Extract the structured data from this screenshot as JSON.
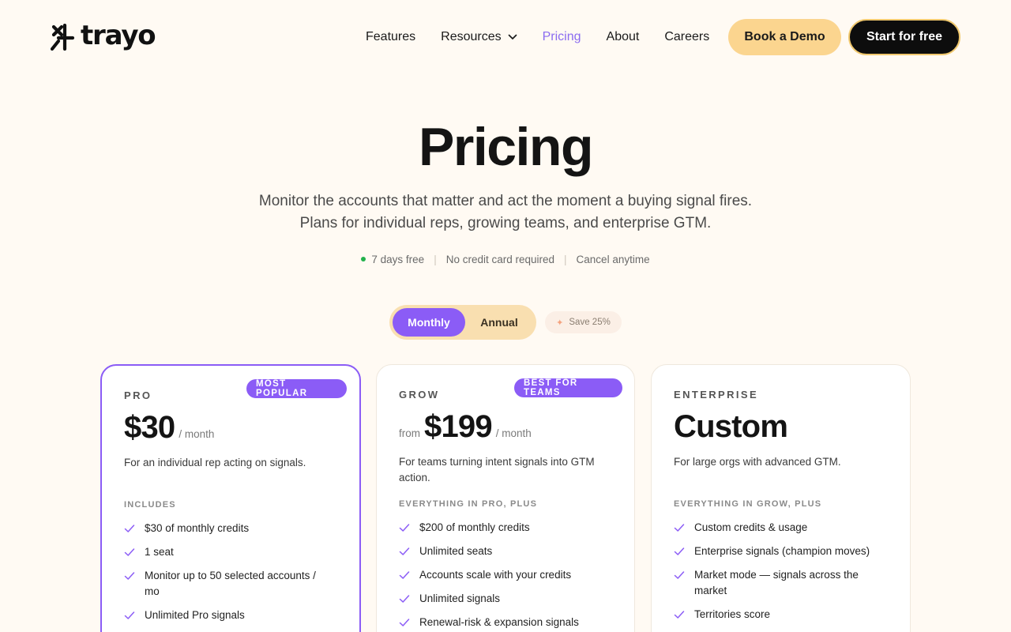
{
  "nav": {
    "logo_text": "trayo",
    "links": [
      {
        "label": "Features"
      },
      {
        "label": "Resources"
      },
      {
        "label": "Pricing"
      },
      {
        "label": "About"
      },
      {
        "label": "Careers"
      }
    ],
    "demo_label": "Book a Demo",
    "start_label": "Start for free",
    "active_link": "Pricing",
    "accent_color": "#8b6cf0"
  },
  "hero": {
    "title": "Pricing",
    "subtitle_line1": "Monitor the accounts that matter and act the moment a buying signal fires.",
    "subtitle_line2": "Plans for individual reps, growing teams, and enterprise GTM.",
    "badges": [
      "7 days free",
      "No credit card required",
      "Cancel anytime"
    ]
  },
  "billing": {
    "monthly_label": "Monthly",
    "annual_label": "Annual",
    "selected": "Monthly",
    "save_label": "Save 25%"
  },
  "plans": [
    {
      "tier": "PRO",
      "tag": "MOST POPULAR",
      "price": "$30",
      "per": "/ month",
      "description": "For an individual rep acting on signals.",
      "includes_label": "INCLUDES",
      "features": [
        "$30 of monthly credits",
        "1 seat",
        "Monitor up to 50 selected accounts / mo",
        "Unlimited Pro signals"
      ]
    },
    {
      "tier": "GROW",
      "tag": "BEST FOR TEAMS",
      "from": "from",
      "price": "$199",
      "per": "/ month",
      "description": "For teams turning intent signals into GTM action.",
      "includes_label": "EVERYTHING IN PRO, PLUS",
      "features": [
        "$200 of monthly credits",
        "Unlimited seats",
        "Accounts scale with your credits",
        "Unlimited signals",
        "Renewal-risk & expansion signals"
      ]
    },
    {
      "tier": "ENTERPRISE",
      "price": "Custom",
      "description": "For large orgs with advanced GTM.",
      "includes_label": "EVERYTHING IN GROW, PLUS",
      "features": [
        "Custom credits & usage",
        "Enterprise signals (champion moves)",
        "Market mode — signals across the market",
        "Territories score"
      ]
    }
  ],
  "colors": {
    "background": "#fffaf3",
    "brand_purple": "#8b5cf6",
    "demo_button": "#fbd58f",
    "toggle_bg": "#f9dfb0",
    "check": "#8b5cf6"
  },
  "icons": [
    "trayo-logo-mark",
    "chevron-down-icon",
    "check-icon",
    "sparkle-icon"
  ]
}
